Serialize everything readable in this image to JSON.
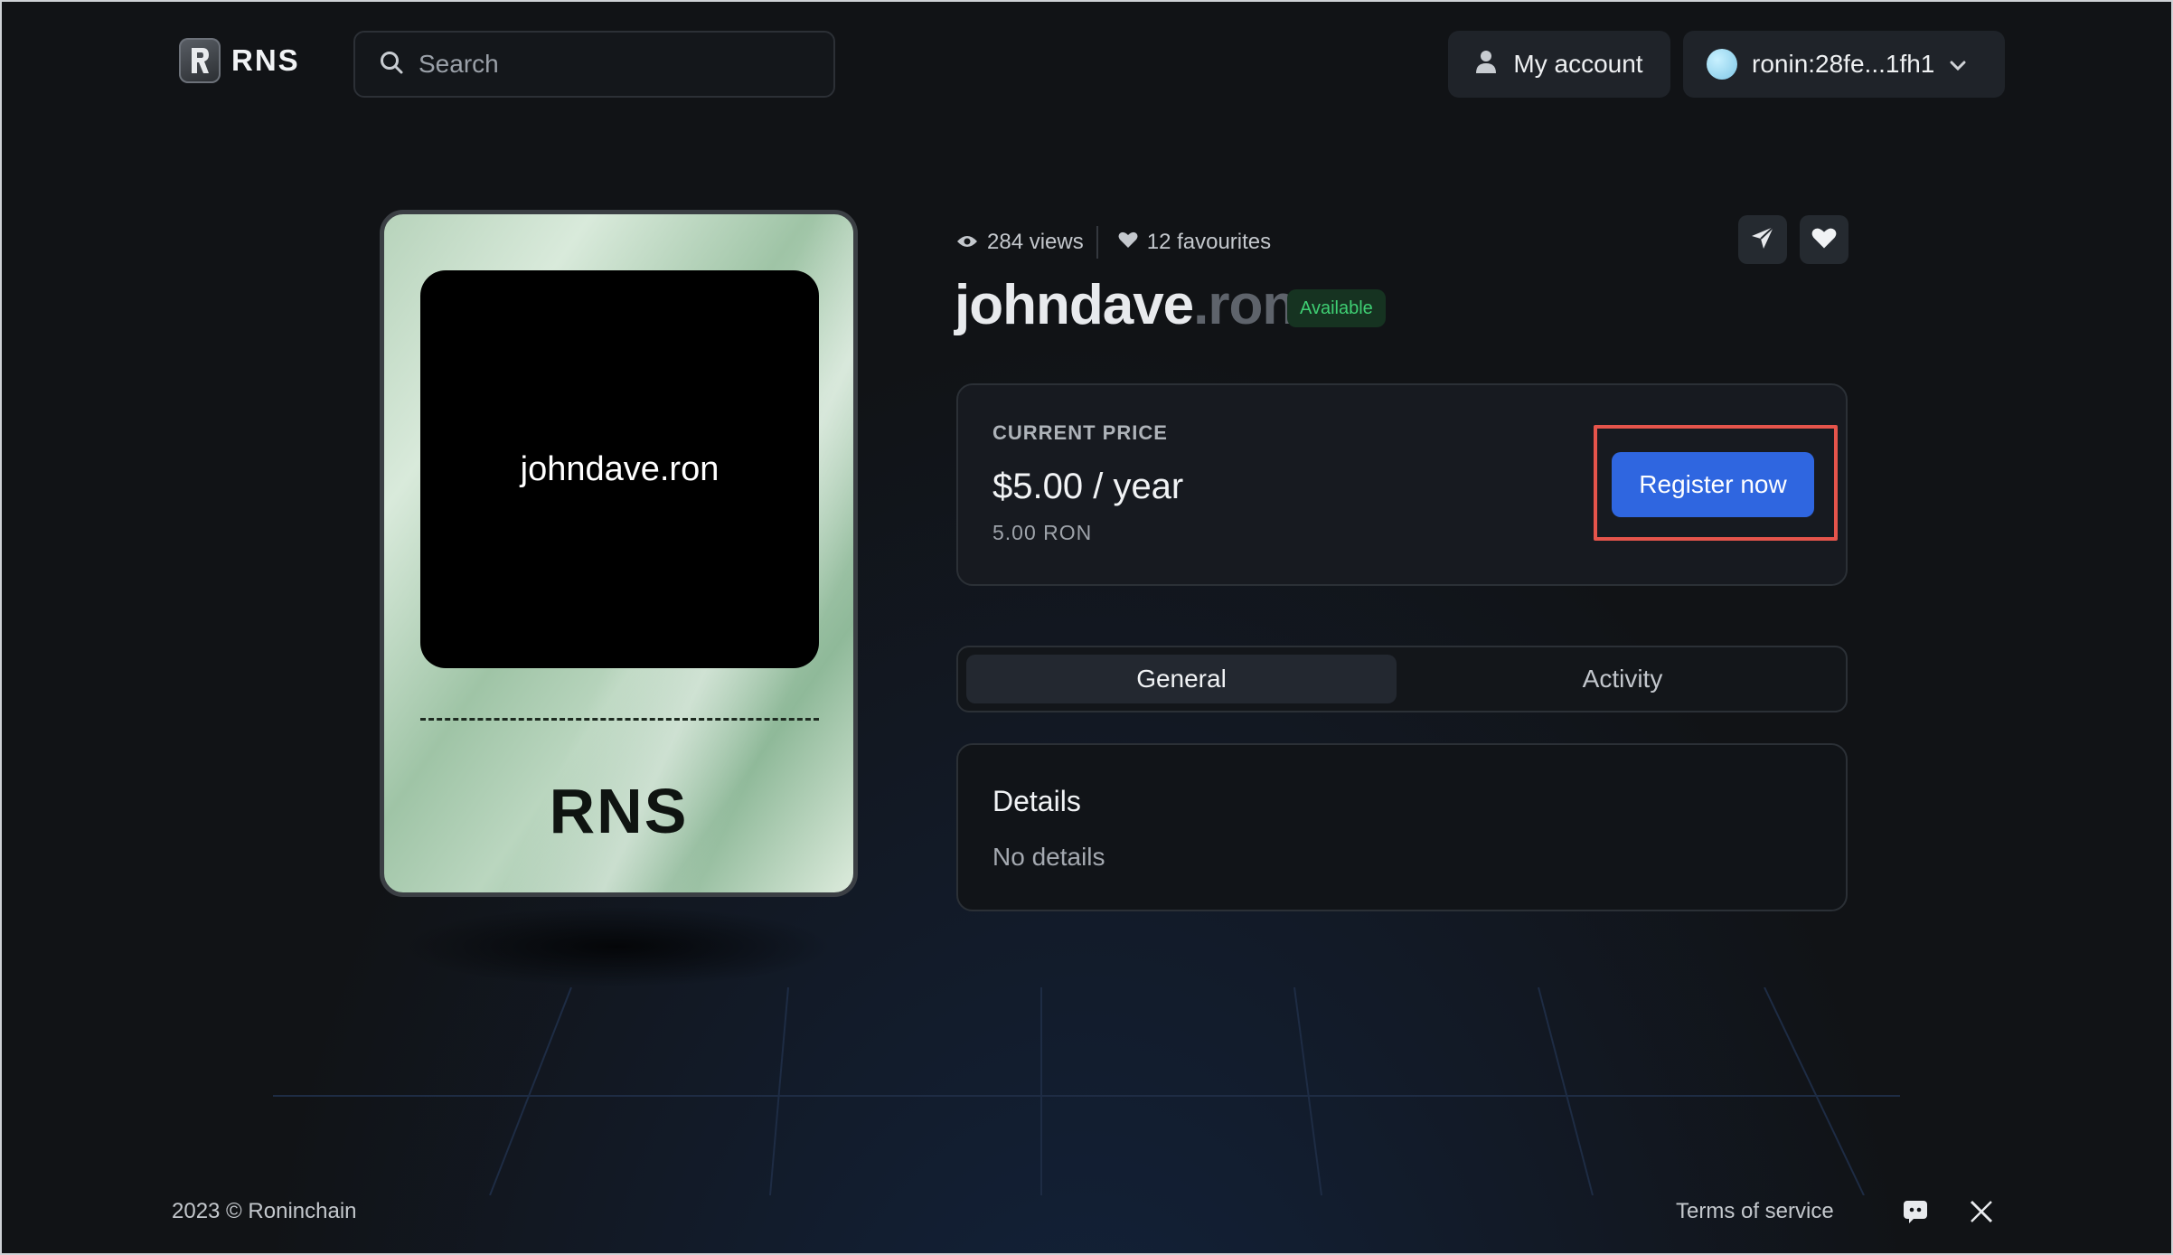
{
  "header": {
    "logo_text": "RNS",
    "search_placeholder": "Search",
    "account_label": "My account",
    "wallet_address": "ronin:28fe...1fh1"
  },
  "card": {
    "name": "johndave.ron",
    "brand": "RNS"
  },
  "domain": {
    "name": "johndave",
    "tld": ".ron",
    "status": "Available",
    "views": "284 views",
    "favourites": "12 favourites"
  },
  "price": {
    "label": "CURRENT PRICE",
    "value": "$5.00 / year",
    "ron": "5.00 RON",
    "register_label": "Register now"
  },
  "tabs": [
    {
      "label": "General",
      "active": true
    },
    {
      "label": "Activity",
      "active": false
    }
  ],
  "details": {
    "title": "Details",
    "body": "No details"
  },
  "footer": {
    "copyright": "2023 © Roninchain",
    "terms": "Terms of service"
  },
  "colors": {
    "accent": "#2f66e0",
    "available": "#3fcf73",
    "highlight": "#e5544b"
  }
}
